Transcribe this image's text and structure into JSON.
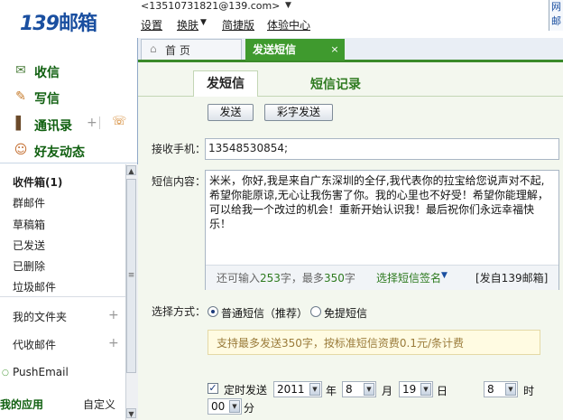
{
  "header": {
    "logo_num": "139",
    "logo_text": "邮箱",
    "email": "<13510731821@139.com>",
    "links": [
      "设置",
      "换肤",
      "简捷版",
      "体验中心"
    ],
    "right_box": [
      "网",
      "邮"
    ]
  },
  "sidebar": {
    "main_items": [
      {
        "label": "收信",
        "icon": "inbox-icon"
      },
      {
        "label": "写信",
        "icon": "compose-icon"
      },
      {
        "label": "通讯录",
        "icon": "addressbook-icon"
      },
      {
        "label": "好友动态",
        "icon": "friends-icon"
      }
    ],
    "folders": [
      "收件箱(1)",
      "群邮件",
      "草稿箱",
      "已发送",
      "已删除",
      "垃圾邮件"
    ],
    "my_folders": "我的文件夹",
    "collect": "代收邮件",
    "pushemail": "PushEmail",
    "my_apps": "我的应用",
    "customize": "自定义"
  },
  "tabs": {
    "home": "首 页",
    "send_sms": "发送短信"
  },
  "subtabs": {
    "sms": "发短信",
    "history": "短信记录"
  },
  "buttons": {
    "send": "发送",
    "mms": "彩字发送"
  },
  "form": {
    "recipient_label": "接收手机：",
    "recipient_value": "13548530854;",
    "content_label": "短信内容：",
    "content": "米米，你好,我是来自广东深圳的全仔,我代表你的拉宝给您说声对不起,希望你能原谅,无心让我伤害了你。我的心里也不好受！希望你能理解，可以给我一个改过的机会！重新开始认识我！最后祝你们永远幸福快乐！",
    "remain_prefix": "还可输入",
    "remain_count": "253",
    "remain_mid": "字，最多",
    "remain_max": "350",
    "remain_suffix": "字",
    "signature_select": "选择短信签名",
    "signature_tag": "[发自139邮箱]",
    "method_label": "选择方式：",
    "method_normal": "普通短信（推荐）",
    "method_free": "免提短信",
    "tip": "支持最多发送350字，按标准短信资费0.1元/条计费",
    "timed_label": "定时发送",
    "year": "2011",
    "year_unit": "年",
    "month": "8",
    "month_unit": "月",
    "day": "19",
    "day_unit": "日",
    "hour": "8",
    "hour_unit": "时",
    "minute": "00",
    "minute_unit": "分"
  },
  "colors": {
    "accent_green": "#3f9a2e",
    "brand_blue": "#1a4fa0"
  }
}
